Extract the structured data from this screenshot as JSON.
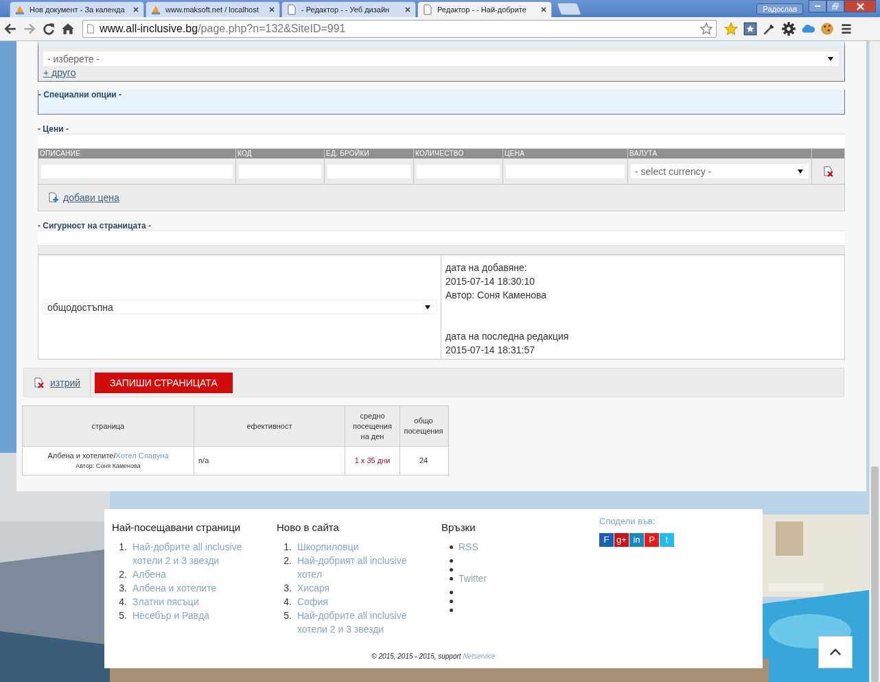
{
  "browser": {
    "tabs": [
      {
        "title": "Нов документ - За календа",
        "kind": "pma",
        "selected": false
      },
      {
        "title": "www.maksoft.net / localhost",
        "kind": "pma",
        "selected": false
      },
      {
        "title": "- Редактор - - Уеб дизайн",
        "kind": "page",
        "selected": false
      },
      {
        "title": "Редактор - - Най-добрите",
        "kind": "page",
        "selected": true
      }
    ],
    "user": "Радослав",
    "url_host": "www.all-inclusive.bg",
    "url_path": "/page.php?n=132&SiteID=991"
  },
  "form": {
    "category_placeholder": "- изберете -",
    "other_link": "+ друго",
    "special_legend": "- Специални опции -",
    "prices": {
      "legend": "- Цени -",
      "columns": [
        "ОПИСАНИЕ",
        "КОД",
        "ЕД. БРОЙКИ",
        "КОЛИЧЕСТВО",
        "ЦЕНА",
        "ВАЛУТА"
      ],
      "currency_placeholder": "- select currency -",
      "add_link": "добави цена"
    },
    "security": {
      "legend": "- Сигурност на страницата -",
      "access": "общодостъпна",
      "added_label": "дата на добавяне:",
      "added_date": "2015-07-14 18:30:10",
      "author": "Автор: Соня Каменова",
      "edited_label": "дата на последна редакция",
      "edited_date": "2015-07-14 18:31:57"
    },
    "delete_link": "изтрий",
    "save_button": "ЗАПИШИ СТРАНИЦАТА"
  },
  "stats": {
    "columns": [
      "страница",
      "ефективност",
      "средно посещения на ден",
      "общо посещения"
    ],
    "row": {
      "page_parent": "Албена и хотелите/",
      "page_link": "Хотел Славуна",
      "author": "Автор: Соня Каменова",
      "efficiency": "n/a",
      "average": "1 x 35 дни",
      "total": "24"
    }
  },
  "footer": {
    "columns": [
      {
        "title": "Най-посещавани страници",
        "items": [
          {
            "kind": "link",
            "number": "1.",
            "text": "Най-добрите all inclusive хотели 2 и 3 звезди"
          },
          {
            "kind": "link",
            "number": "2.",
            "text": "Албена"
          },
          {
            "kind": "link",
            "number": "3.",
            "text": "Албена и хотелите"
          },
          {
            "kind": "link",
            "number": "4.",
            "text": "Златни пясъци"
          },
          {
            "kind": "link",
            "number": "5.",
            "text": "Несебър и Равда"
          }
        ]
      },
      {
        "title": "Ново в сайта",
        "items": [
          {
            "kind": "link",
            "number": "1.",
            "text": "Шкорпиловци"
          },
          {
            "kind": "link",
            "number": "2.",
            "text": "Най-добрият all inclusive хотел"
          },
          {
            "kind": "link",
            "number": "3.",
            "text": "Хисаря"
          },
          {
            "kind": "link",
            "number": "4.",
            "text": "София"
          },
          {
            "kind": "link",
            "number": "5.",
            "text": "Най-добрите all inclusive хотели 2 и 3 звезди"
          }
        ]
      },
      {
        "title": "Връзки",
        "items": [
          {
            "kind": "link",
            "text": "RSS"
          },
          {
            "kind": "empty"
          },
          {
            "kind": "empty"
          },
          {
            "kind": "link",
            "text": "Twitter"
          },
          {
            "kind": "empty"
          },
          {
            "kind": "empty"
          },
          {
            "kind": "empty"
          }
        ]
      }
    ],
    "share_label": "Сподели във:",
    "share_buttons": [
      {
        "label": "F",
        "color": "#1a5fb4"
      },
      {
        "label": "g+",
        "color": "#c4161c"
      },
      {
        "label": "in",
        "color": "#1b86b8"
      },
      {
        "label": "P",
        "color": "#e31d1d"
      },
      {
        "label": "t",
        "color": "#22bbee"
      }
    ],
    "copyright": "© 2015, 2015 - 2015, support ",
    "support_link": "Netservice"
  }
}
